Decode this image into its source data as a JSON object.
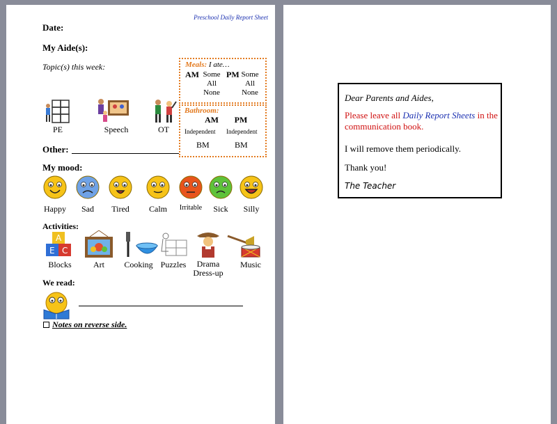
{
  "left_page": {
    "header_title": "Preschool Daily Report Sheet",
    "date_label": "Date:",
    "aide_label": "My Aide(s):",
    "topic_label": "Topic(s) this week:",
    "therapies": [
      {
        "label": "PE",
        "icon": "climbing-child-icon"
      },
      {
        "label": "Speech",
        "icon": "speech-class-icon"
      },
      {
        "label": "OT",
        "icon": "occupational-therapy-icon"
      }
    ],
    "other_label": "Other: ",
    "meals": {
      "title": "Meals:",
      "subtitle": "I ate…",
      "am_label": "AM",
      "pm_label": "PM",
      "am_options": [
        "Some",
        "All",
        "None"
      ],
      "pm_options": [
        "Some",
        "All",
        "None"
      ]
    },
    "bathroom": {
      "title": "Bathroom:",
      "am_label": "AM",
      "pm_label": "PM",
      "am_independent": "Independent",
      "pm_independent": "Independent",
      "am_bm": "BM",
      "pm_bm": "BM"
    },
    "mood_label": "My mood:",
    "moods": [
      {
        "label": "Happy",
        "color": "#f6c318"
      },
      {
        "label": "Sad",
        "color": "#6fa2e6"
      },
      {
        "label": "Tired",
        "color": "#f6c318"
      },
      {
        "label": "Calm",
        "color": "#f6c318"
      },
      {
        "label": "Irritable",
        "color": "#e8541c"
      },
      {
        "label": "Sick",
        "color": "#5ec23a"
      },
      {
        "label": "Silly",
        "color": "#f6c318"
      }
    ],
    "activities_label": "Activities:",
    "activities": [
      {
        "label": "Blocks",
        "icon": "blocks-icon"
      },
      {
        "label": "Art",
        "icon": "art-painting-icon"
      },
      {
        "label": "Cooking",
        "icon": "cooking-icon"
      },
      {
        "label": "Puzzles",
        "icon": "puzzle-icon"
      },
      {
        "label": "Drama\nDress-up",
        "label1": "Drama",
        "label2": "Dress-up",
        "icon": "dress-up-icon"
      },
      {
        "label": "Music",
        "icon": "music-instruments-icon"
      }
    ],
    "we_read_label": "We read:",
    "notes_label": "Notes on reverse side."
  },
  "right_page": {
    "greeting": "Dear Parents and Aides,",
    "message_prefix": "Please leave all ",
    "message_em": "Daily Report Sheets",
    "message_suffix": " in the communication book.",
    "remove_note": "I will remove them periodically.",
    "thanks": "Thank you!",
    "signature": "The Teacher"
  }
}
